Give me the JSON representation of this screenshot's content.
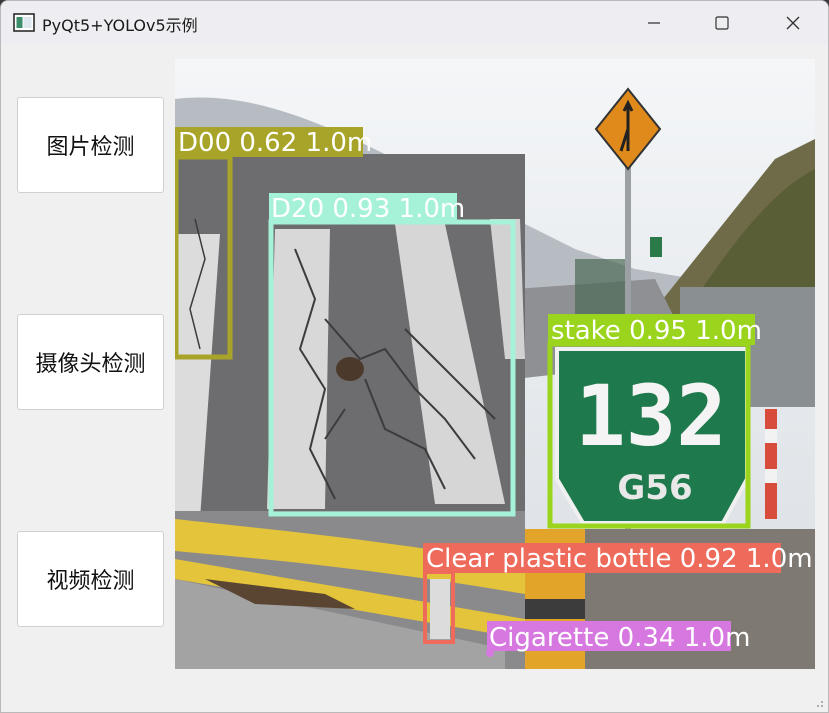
{
  "window": {
    "title": "PyQt5+YOLOv5示例",
    "controls": [
      "minimize-icon",
      "maximize-icon",
      "close-icon"
    ]
  },
  "sidebar": {
    "buttons": [
      {
        "label": "图片检测"
      },
      {
        "label": "摄像头检测"
      },
      {
        "label": "视频检测"
      }
    ]
  },
  "viewer": {
    "sign": {
      "number": "132",
      "code": "G56"
    },
    "detections": [
      {
        "label": "D00 0.62  1.0m",
        "color": "#a8a42a"
      },
      {
        "label": "D20 0.93  1.0m",
        "color": "#a6f2d8"
      },
      {
        "label": "stake 0.95  1.0m",
        "color": "#9ad41c"
      },
      {
        "label": "Clear plastic bottle 0.92  1.0m",
        "color": "#ee6b5c"
      },
      {
        "label": "Cigarette 0.34  1.0m",
        "color": "#d678e0"
      }
    ]
  },
  "colors": {
    "window_bg": "#f0f0f0",
    "titlebar_bg": "#eeeef2",
    "button_bg": "#ffffff"
  }
}
